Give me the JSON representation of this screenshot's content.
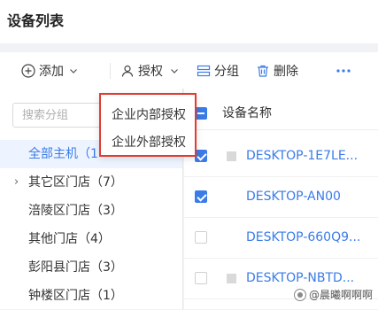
{
  "page": {
    "title": "设备列表"
  },
  "toolbar": {
    "add": {
      "label": "添加",
      "icon": "plus-circle-icon"
    },
    "authorize": {
      "label": "授权",
      "icon": "user-icon"
    },
    "group": {
      "label": "分组",
      "icon": "group-icon"
    },
    "delete": {
      "label": "删除",
      "icon": "trash-icon"
    },
    "more": {
      "icon": "more-dots-icon"
    }
  },
  "authorize_menu": {
    "items": [
      "企业内部授权",
      "企业外部授权"
    ],
    "highlight_color": "#e03c31"
  },
  "sidebar": {
    "search_placeholder": "搜索分组",
    "groups": [
      {
        "label": "全部主机（1",
        "active": true,
        "expandable": false
      },
      {
        "label": "其它区门店（7）",
        "active": false,
        "expandable": true
      },
      {
        "label": "涪陵区门店（3）",
        "active": false,
        "expandable": false
      },
      {
        "label": "其他门店（4）",
        "active": false,
        "expandable": false
      },
      {
        "label": "彭阳县门店（3）",
        "active": false,
        "expandable": false
      },
      {
        "label": "钟楼区门店（1）",
        "active": false,
        "expandable": false
      }
    ]
  },
  "table": {
    "header": {
      "device_name": "设备名称"
    },
    "rows": [
      {
        "name": "DESKTOP-1E7LE...",
        "checked": true
      },
      {
        "name": "DESKTOP-AN00",
        "checked": true
      },
      {
        "name": "DESKTOP-660Q9...",
        "checked": false
      },
      {
        "name": "DESKTOP-NBTD...",
        "checked": false
      }
    ]
  },
  "watermark": {
    "text": "@晨曦啊啊啊"
  },
  "colors": {
    "accent": "#3a7be8",
    "active_bg": "#eef4ff"
  }
}
